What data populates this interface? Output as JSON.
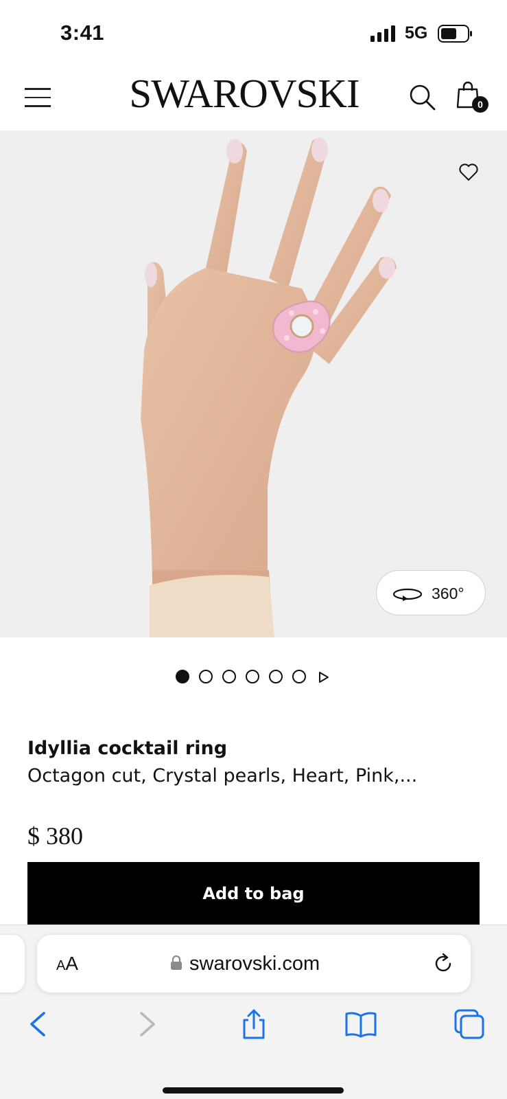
{
  "status_bar": {
    "time": "3:41",
    "network": "5G",
    "icons": [
      "signal-icon",
      "battery-icon"
    ]
  },
  "header": {
    "logo": "SWAROVSKI",
    "bag_count": "0",
    "icons": [
      "menu-icon",
      "search-icon",
      "bag-icon"
    ]
  },
  "gallery": {
    "view360_label": "360°",
    "total_images": 6,
    "active_index": 0,
    "icons": [
      "heart-icon",
      "rotate-360-icon",
      "play-icon"
    ]
  },
  "product": {
    "name": "Idyllia cocktail ring",
    "description": "Octagon cut, Crystal pearls, Heart, Pink,...",
    "price": "$ 380",
    "add_to_bag_label": "Add to bag"
  },
  "browser": {
    "aa_small": "A",
    "aa_big": "A",
    "url": "swarovski.com",
    "icons": [
      "lock-icon",
      "reload-icon",
      "back-icon",
      "forward-icon",
      "share-icon",
      "bookmarks-icon",
      "tabs-icon"
    ],
    "colors": {
      "accent": "#1a73e8",
      "disabled": "#b9b9bd"
    }
  }
}
